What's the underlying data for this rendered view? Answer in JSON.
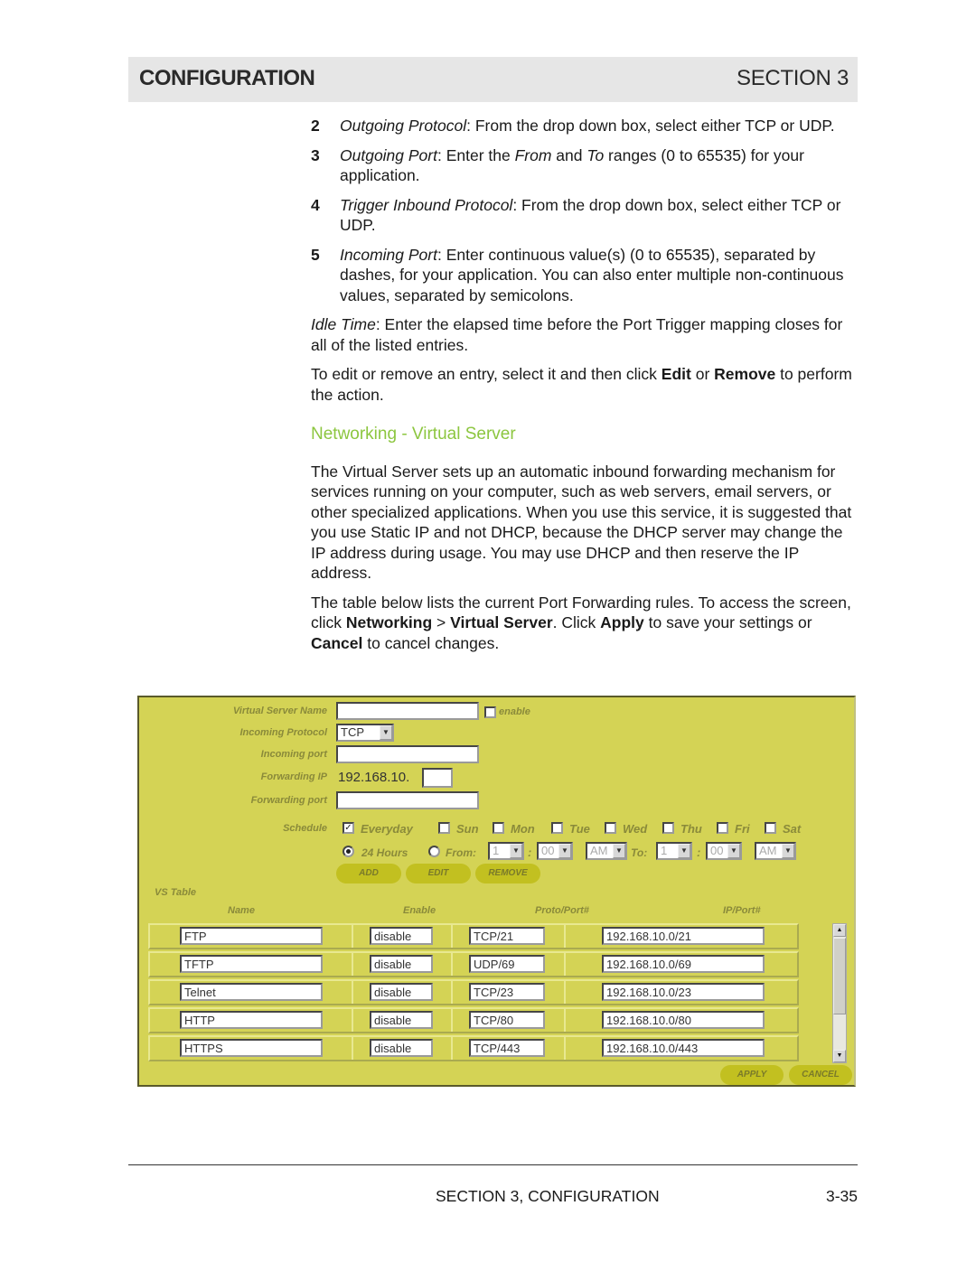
{
  "header": {
    "left": "CONFIGURATION",
    "right": "SECTION 3"
  },
  "steps": [
    {
      "num": "2",
      "term": "Outgoing Protocol",
      "text": ": From the drop down box, select either TCP or UDP."
    },
    {
      "num": "3",
      "term": "Outgoing Port",
      "text_a": ": Enter the ",
      "em1": "From",
      "text_b": " and ",
      "em2": "To",
      "text_c": " ranges (0 to 65535) for your application."
    },
    {
      "num": "4",
      "term": "Trigger Inbound Protocol",
      "text": ": From the drop down box, select either TCP or UDP."
    },
    {
      "num": "5",
      "term": "Incoming Port",
      "text": ": Enter continuous value(s) (0 to 65535), separated by dashes, for your application. You can also enter multiple non-continuous values, separated by semicolons."
    }
  ],
  "idle": {
    "term": "Idle Time",
    "text": ": Enter the elapsed time before the Port Trigger mapping closes for all of the listed entries."
  },
  "edit_para": {
    "a": "To edit or remove an entry, select it and then click ",
    "b1": "Edit",
    "c": " or ",
    "b2": "Remove",
    "d": " to perform the action."
  },
  "section_heading": "Networking - Virtual Server",
  "intro": "The Virtual Server sets up an automatic inbound forwarding mechanism for services running on your computer, such as web servers, email servers, or other specialized applications. When you use this service, it is suggested that you use Static IP and not DHCP, because the DHCP server may change the IP address during usage. You may use DHCP and then reserve the IP address.",
  "table_para": {
    "a": "The table below lists the current Port Forwarding rules. To access the screen, click ",
    "b1": "Networking",
    "c": " > ",
    "b2": "Virtual Server",
    "d": ". Click ",
    "b3": "Apply",
    "e": " to save your settings or ",
    "b4": "Cancel",
    "f": " to cancel changes."
  },
  "panel": {
    "labels": {
      "name": "Virtual Server Name",
      "protocol": "Incoming Protocol",
      "in_port": "Incoming port",
      "fwd_ip": "Forwarding IP",
      "fwd_port": "Forwarding port",
      "schedule": "Schedule"
    },
    "enable_label": "enable",
    "protocol_value": "TCP",
    "ip_prefix": "192.168.10.",
    "days": [
      "Everyday",
      "Sun",
      "Mon",
      "Tue",
      "Wed",
      "Thu",
      "Fri",
      "Sat"
    ],
    "hours_24": "24 Hours",
    "from_label": "From:",
    "to_label": "To:",
    "from_hour": "1",
    "from_min": "00",
    "from_ampm": "AM",
    "to_hour": "1",
    "to_min": "00",
    "to_ampm": "AM",
    "buttons": {
      "add": "ADD",
      "edit": "EDIT",
      "remove": "REMOVE",
      "apply": "APPLY",
      "cancel": "CANCEL"
    },
    "vs_table_title": "VS Table",
    "columns": [
      "Name",
      "Enable",
      "Proto/Port#",
      "IP/Port#"
    ],
    "rows": [
      {
        "name": "FTP",
        "enable": "disable",
        "proto": "TCP/21",
        "ip": "192.168.10.0/21"
      },
      {
        "name": "TFTP",
        "enable": "disable",
        "proto": "UDP/69",
        "ip": "192.168.10.0/69"
      },
      {
        "name": "Telnet",
        "enable": "disable",
        "proto": "TCP/23",
        "ip": "192.168.10.0/23"
      },
      {
        "name": "HTTP",
        "enable": "disable",
        "proto": "TCP/80",
        "ip": "192.168.10.0/80"
      },
      {
        "name": "HTTPS",
        "enable": "disable",
        "proto": "TCP/443",
        "ip": "192.168.10.0/443"
      }
    ]
  },
  "footer": {
    "left": "SECTION 3, CONFIGURATION",
    "right": "3-35"
  }
}
